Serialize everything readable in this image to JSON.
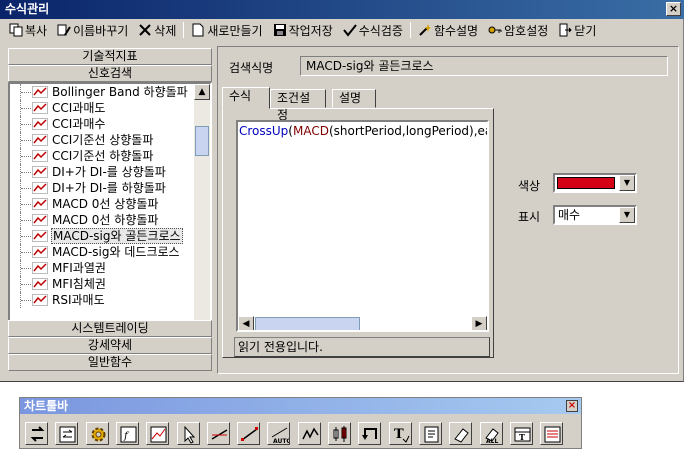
{
  "window": {
    "title": "수식관리"
  },
  "toolbar": {
    "copy": "복사",
    "rename": "이름바꾸기",
    "delete": "삭제",
    "new": "새로만들기",
    "save": "작업저장",
    "verify": "수식검증",
    "func_desc": "함수설명",
    "password": "암호설정",
    "close": "닫기"
  },
  "categories": {
    "tech_indicator": "기술적지표",
    "signal_search": "신호검색",
    "system_trading": "시스템트레이딩",
    "strong_weak": "강세약세",
    "general_func": "일반함수"
  },
  "tree_items": [
    "Bollinger Band 하향돌파",
    "CCI과매도",
    "CCI과매수",
    "CCI기준선 상향돌파",
    "CCI기준선 하향돌파",
    "DI+가 DI-를 상향돌파",
    "DI+가 DI-를 하향돌파",
    "MACD 0선 상향돌파",
    "MACD 0선 하향돌파",
    "MACD-sig와 골든크로스",
    "MACD-sig와 데드크로스",
    "MFI과열권",
    "MFI침체권",
    "RSI과매도"
  ],
  "selected_item": "MACD-sig와 골든크로스",
  "form": {
    "search_name_label": "검색식명",
    "search_name_value": "MACD-sig와 골든크로스"
  },
  "tabs": {
    "formula": "수식",
    "condition": "조건설정",
    "description": "설명"
  },
  "editor": {
    "fn": "CrossUp",
    "open": "(",
    "fn2": "MACD",
    "args": "(shortPeriod,longPeriod),eav"
  },
  "status_text": "읽기 전용입니다.",
  "color_label": "색상",
  "color_value": "#d40015",
  "display_label": "표시",
  "display_value": "매수",
  "chart_toolbar": {
    "title": "차트툴바",
    "buttons": [
      "cycle-icon",
      "swap-icon",
      "gear-icon",
      "formula-icon",
      "chart-grid-icon",
      "cursor-icon",
      "line-icon",
      "trendline-icon",
      "auto-trend-icon",
      "wave-icon",
      "candle-icon",
      "arrow-icon",
      "text-icon",
      "note-icon",
      "eraser-icon",
      "erase-all-icon",
      "table-icon",
      "list-icon"
    ]
  }
}
